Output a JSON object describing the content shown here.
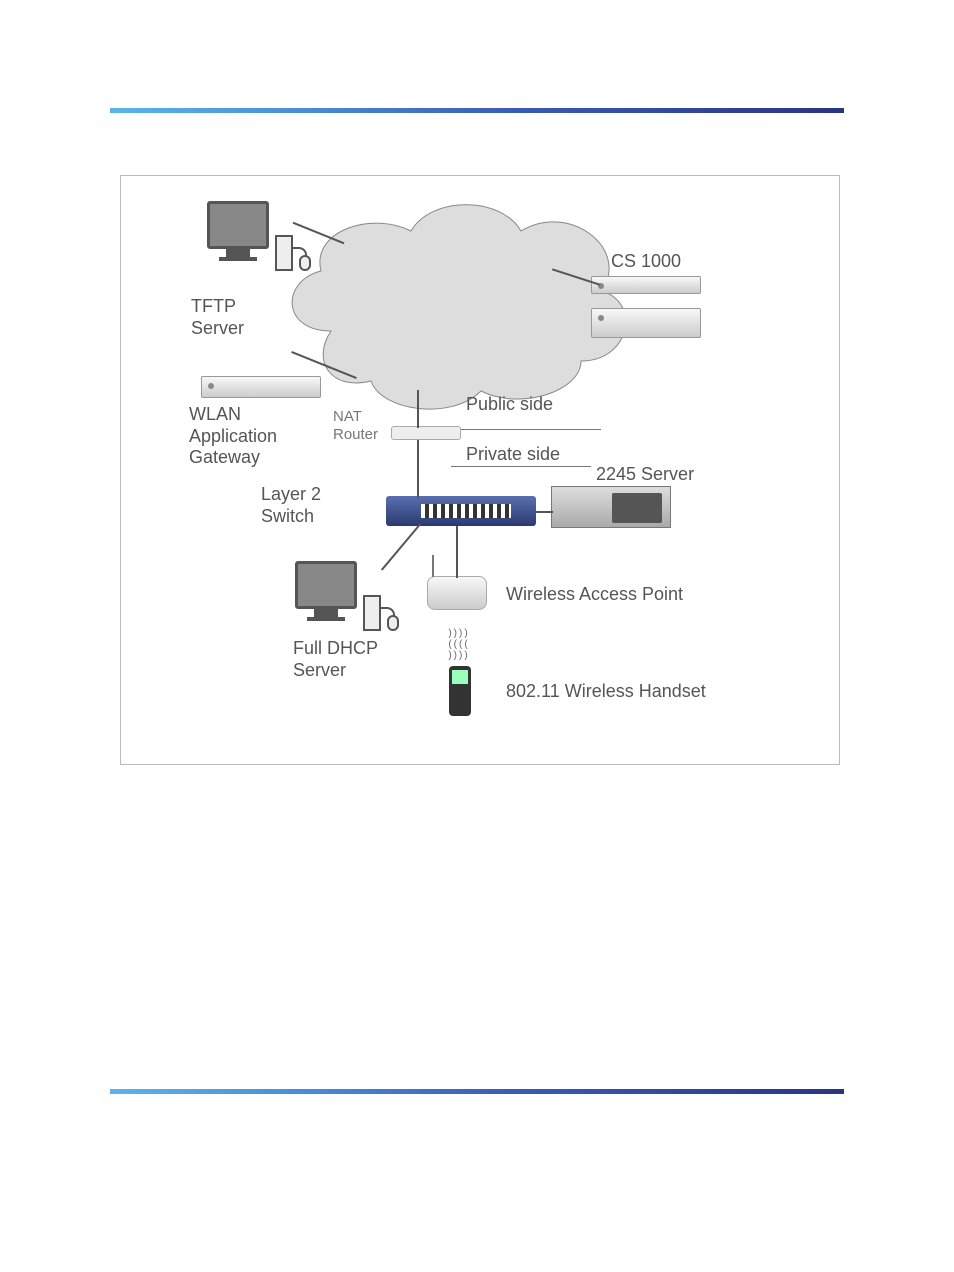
{
  "rules": {},
  "figure": {
    "labels": {
      "tftp_server": "TFTP\nServer",
      "wlan_gateway": "WLAN\nApplication\nGateway",
      "nat_router": "NAT\nRouter",
      "layer2_switch": "Layer 2\nSwitch",
      "cs1000": "CS 1000",
      "public_side": "Public side",
      "private_side": "Private side",
      "server_2245": "2245 Server",
      "full_dhcp": "Full DHCP\nServer",
      "wireless_ap": "Wireless Access Point",
      "wireless_handset": "802.11 Wireless Handset"
    }
  }
}
